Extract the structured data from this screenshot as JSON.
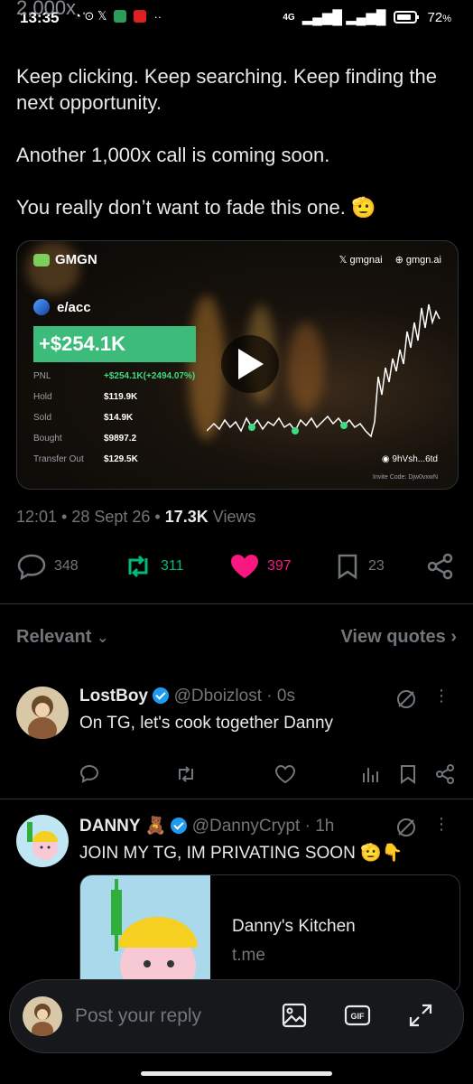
{
  "status_bar": {
    "time": "13:35",
    "network": "4G",
    "battery": "72"
  },
  "tweet": {
    "clipped_top": "2,000x .",
    "paragraphs": [
      "Keep clicking. Keep searching. Keep finding the next opportunity.",
      "Another 1,000x call is coming soon.",
      "You really don’t want to fade this one. 🫡"
    ],
    "media": {
      "brand": "GMGN",
      "link_x": "gmgnai",
      "link_web": "gmgn.ai",
      "token": "e/acc",
      "pnl_big": "+$254.1K",
      "stats": [
        {
          "k": "PNL",
          "v": "+$254.1K(+2494.07%)"
        },
        {
          "k": "Hold",
          "v": "$119.9K"
        },
        {
          "k": "Sold",
          "v": "$14.9K"
        },
        {
          "k": "Bought",
          "v": "$9897.2"
        },
        {
          "k": "Transfer Out",
          "v": "$129.5K"
        }
      ],
      "wallet": "9hVsh...6td",
      "invite": "Invite Code: Djw0vxwN"
    },
    "timestamp": "12:01 • 28 Sept 26 • ",
    "views_count": "17.3K",
    "views_label": " Views",
    "actions": {
      "replies": "348",
      "reposts": "311",
      "likes": "397",
      "bookmarks": "23"
    },
    "colors": {
      "repost": "#00ba7c",
      "like": "#f91880"
    }
  },
  "sort": {
    "relevant": "Relevant",
    "view_quotes": "View quotes"
  },
  "replies": [
    {
      "name": "LostBoy",
      "handle": "@Dboizlost · 0s",
      "text": "On TG, let's cook together Danny"
    },
    {
      "name": "DANNY 🧸",
      "handle": "@DannyCrypt · 1h",
      "text": "JOIN MY TG, IM PRIVATING SOON 🫡👇",
      "card_title": "Danny's Kitchen",
      "card_url": "t.me"
    }
  ],
  "composer": {
    "placeholder": "Post your reply"
  }
}
